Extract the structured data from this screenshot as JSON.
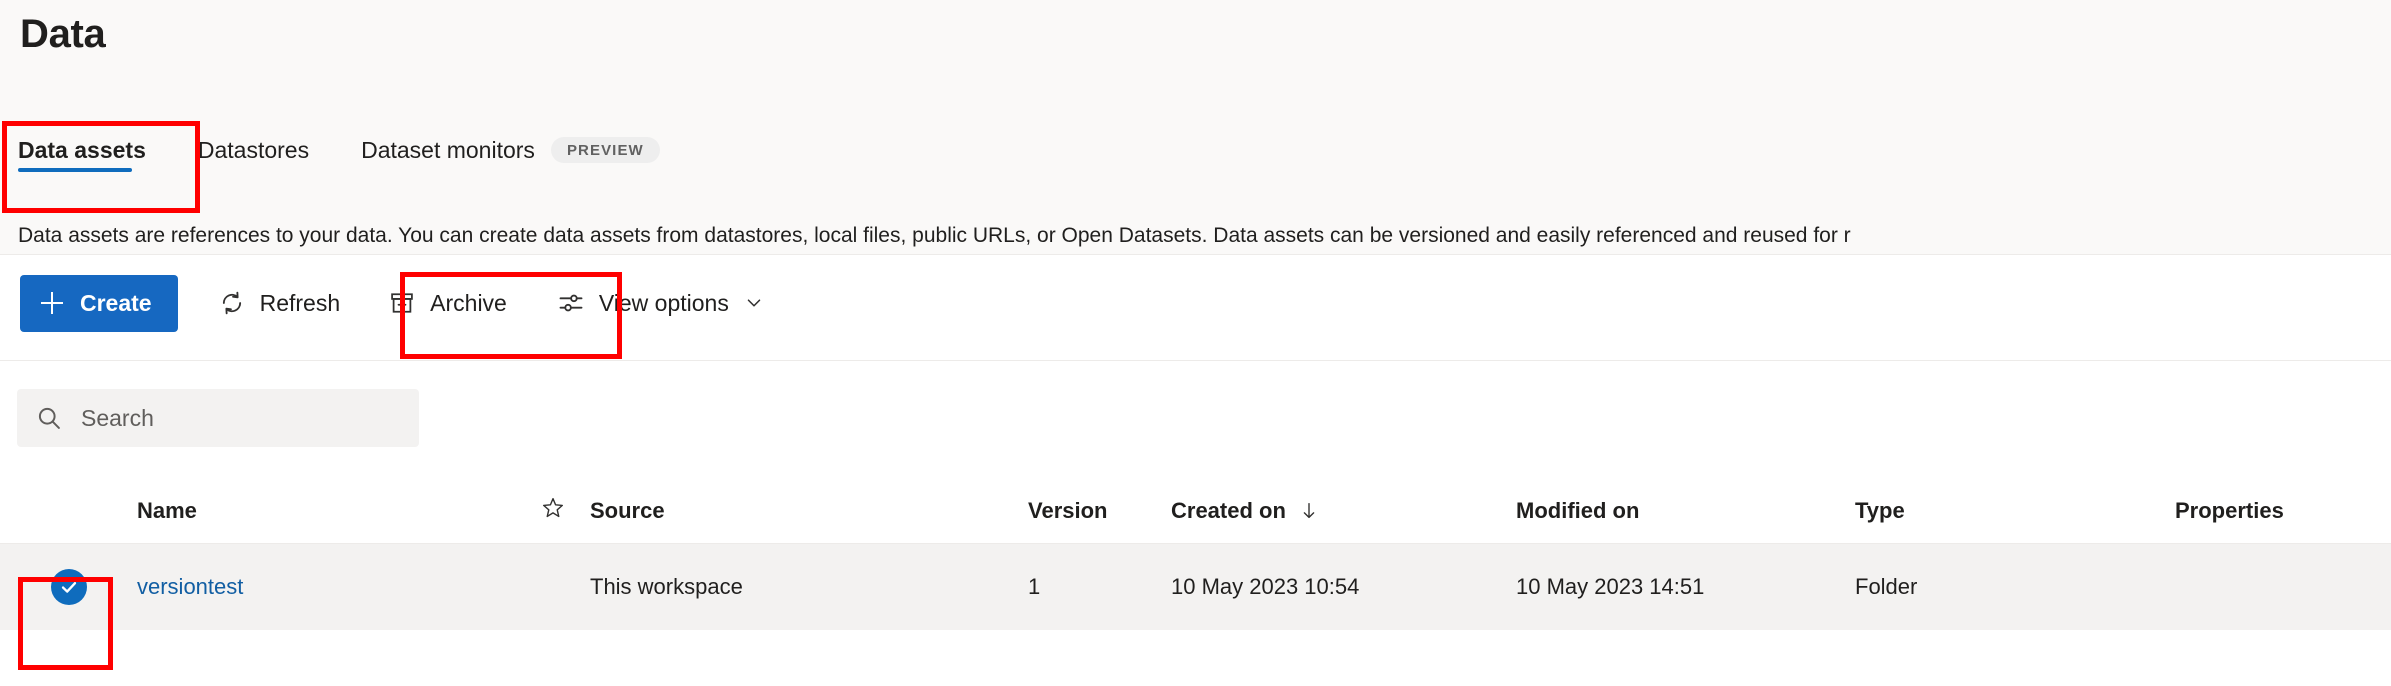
{
  "page": {
    "title": "Data",
    "description": "Data assets are references to your data. You can create data assets from datastores, local files, public URLs, or Open Datasets. Data assets can be versioned and easily referenced and reused for r"
  },
  "tabs": [
    {
      "label": "Data assets",
      "selected": true,
      "badge": ""
    },
    {
      "label": "Datastores",
      "selected": false,
      "badge": ""
    },
    {
      "label": "Dataset monitors",
      "selected": false,
      "badge": "PREVIEW"
    }
  ],
  "toolbar": {
    "create_label": "Create",
    "refresh_label": "Refresh",
    "archive_label": "Archive",
    "view_options_label": "View options"
  },
  "search": {
    "placeholder": "Search",
    "value": ""
  },
  "table": {
    "columns": [
      {
        "key": "name",
        "label": "Name"
      },
      {
        "key": "source",
        "label": "Source"
      },
      {
        "key": "version",
        "label": "Version"
      },
      {
        "key": "created",
        "label": "Created on"
      },
      {
        "key": "modified",
        "label": "Modified on"
      },
      {
        "key": "type",
        "label": "Type"
      },
      {
        "key": "properties",
        "label": "Properties"
      }
    ],
    "sort": {
      "column": "Created on",
      "direction": "desc",
      "glyph": "↓"
    },
    "rows": [
      {
        "selected": true,
        "name": "versiontest",
        "source": "This workspace",
        "version": "1",
        "created": "10 May 2023 10:54",
        "modified": "10 May 2023 14:51",
        "type": "Folder",
        "properties": ""
      }
    ]
  },
  "colors": {
    "accent": "#0f6cbd",
    "primary_button": "#1668c1",
    "link": "#115ea3",
    "annotation": "#ff0000",
    "row_selected_bg": "#f3f2f1",
    "header_bg": "#faf9f8"
  }
}
